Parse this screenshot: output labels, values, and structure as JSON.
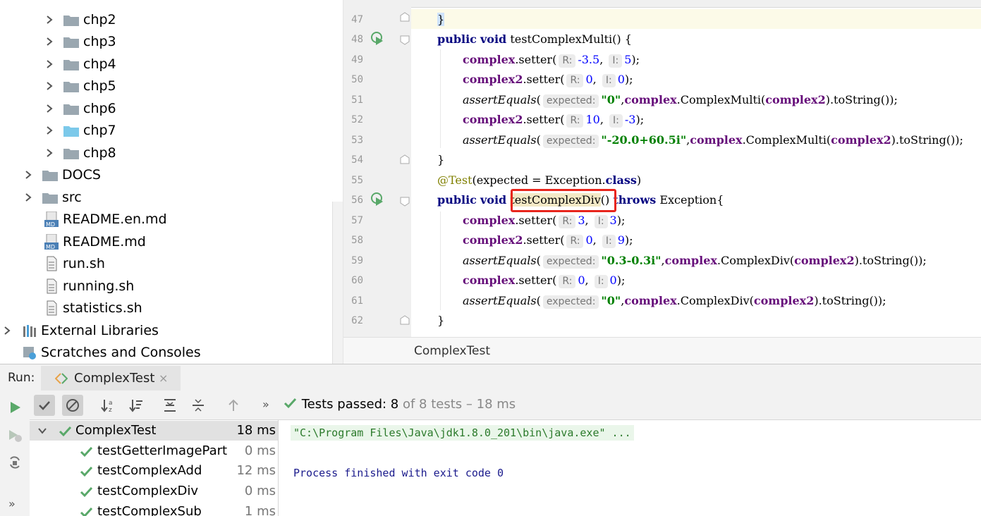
{
  "project_tree": {
    "items": [
      {
        "label": "chp2",
        "kind": "folder"
      },
      {
        "label": "chp3",
        "kind": "folder"
      },
      {
        "label": "chp4",
        "kind": "folder"
      },
      {
        "label": "chp5",
        "kind": "folder"
      },
      {
        "label": "chp6",
        "kind": "folder"
      },
      {
        "label": "chp7",
        "kind": "folder-blue"
      },
      {
        "label": "chp8",
        "kind": "folder"
      },
      {
        "label": "DOCS",
        "kind": "folder"
      },
      {
        "label": "src",
        "kind": "folder"
      },
      {
        "label": "README.en.md",
        "kind": "md-file"
      },
      {
        "label": "README.md",
        "kind": "md-file"
      },
      {
        "label": "run.sh",
        "kind": "sh-file"
      },
      {
        "label": "running.sh",
        "kind": "sh-file"
      },
      {
        "label": "statistics.sh",
        "kind": "sh-file"
      },
      {
        "label": "External Libraries",
        "kind": "libraries"
      },
      {
        "label": "Scratches and Consoles",
        "kind": "scratches"
      }
    ]
  },
  "editor": {
    "line_numbers": [
      "47",
      "48",
      "49",
      "50",
      "51",
      "52",
      "53",
      "54",
      "55",
      "56",
      "57",
      "58",
      "59",
      "60",
      "61",
      "62"
    ],
    "breadcrumb": "ComplexTest",
    "tokens": {
      "brace_close": "}",
      "brace_open": "{",
      "kw_public": "public",
      "kw_void": "void",
      "kw_throws": "throws",
      "kw_class": "class",
      "method_multi": "testComplexMulti",
      "method_div": "testComplexDiv",
      "parens_open": "() {",
      "parens": "()",
      "exception_open": "Exception{",
      "complex": "complex",
      "complex2": "complex2",
      "setter_open": ".setter(",
      "hint_r": "R:",
      "hint_i": "I:",
      "hint_expected": "expected:",
      "assert": "assertEquals",
      "paren_open": "(",
      "close_semi": ");",
      "comma": ",",
      "comma_sp": ", ",
      "dot_multi": ".ComplexMulti(",
      "dot_div": ".ComplexDiv(",
      "to_string": ").toString());",
      "annotation": "@Test",
      "expected_eq": "(expected = Exception.",
      "close_paren": ")",
      "v_m35": "-3.5",
      "v_5": "5",
      "v_0": "0",
      "v_10": "10",
      "v_m3": "-3",
      "v_3": "3",
      "v_9": "9",
      "s_0": "\"0\"",
      "s_m20": "\"-20.0+60.5i\"",
      "s_03": "\"0.3-0.3i\""
    }
  },
  "run_panel": {
    "label": "Run:",
    "tab_title": "ComplexTest",
    "tab_close": "×",
    "status_passed": "Tests passed:",
    "status_count": "8",
    "status_rest": "of 8 tests – 18 ms",
    "more": "»",
    "tests": [
      {
        "name": "ComplexTest",
        "time": "18 ms",
        "root": true
      },
      {
        "name": "testGetterImagePart",
        "time": "0 ms"
      },
      {
        "name": "testComplexAdd",
        "time": "12 ms"
      },
      {
        "name": "testComplexDiv",
        "time": "0 ms"
      },
      {
        "name": "testComplexSub",
        "time": "1 ms"
      }
    ],
    "console_cmd": "\"C:\\Program Files\\Java\\jdk1.8.0_201\\bin\\java.exe\" ...",
    "console_exit": "Process finished with exit code 0"
  },
  "colors": {
    "keyword": "#000080",
    "field": "#660e7a",
    "string": "#008000",
    "number": "#0000ff",
    "highlight_box": "#e8251c",
    "pass_green": "#59a869"
  }
}
